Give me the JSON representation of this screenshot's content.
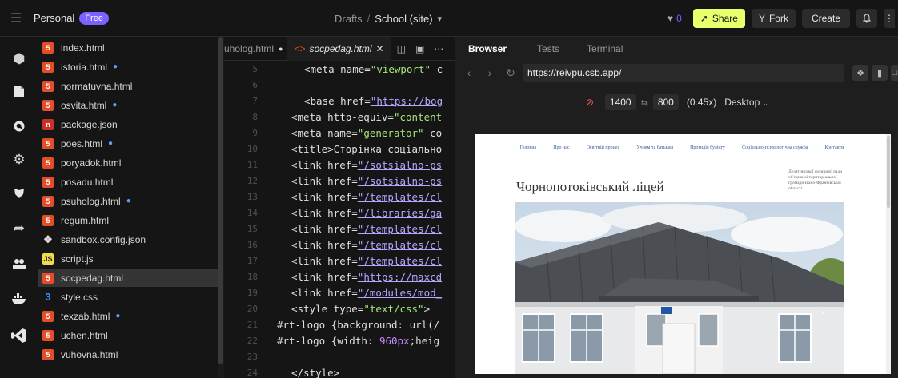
{
  "topbar": {
    "workspace": "Personal",
    "plan_badge": "Free",
    "breadcrumb_drafts": "Drafts",
    "breadcrumb_sep": "/",
    "breadcrumb_title": "School (site)",
    "likes_count": "0",
    "share_label": "Share",
    "fork_label": "Fork",
    "create_label": "Create"
  },
  "activity_icons": [
    "cube-icon",
    "file-icon",
    "search-icon",
    "gear-icon",
    "shield-icon",
    "rocket-icon",
    "users-icon",
    "docker-icon",
    "vscode-icon"
  ],
  "files": [
    {
      "name": "index.html",
      "type": "html",
      "modified": false
    },
    {
      "name": "istoria.html",
      "type": "html",
      "modified": true
    },
    {
      "name": "normatuvna.html",
      "type": "html",
      "modified": false
    },
    {
      "name": "osvita.html",
      "type": "html",
      "modified": true
    },
    {
      "name": "package.json",
      "type": "json",
      "modified": false
    },
    {
      "name": "poes.html",
      "type": "html",
      "modified": true
    },
    {
      "name": "poryadok.html",
      "type": "html",
      "modified": false
    },
    {
      "name": "posadu.html",
      "type": "html",
      "modified": false
    },
    {
      "name": "psuholog.html",
      "type": "html",
      "modified": true
    },
    {
      "name": "regum.html",
      "type": "html",
      "modified": false
    },
    {
      "name": "sandbox.config.json",
      "type": "sb",
      "modified": false
    },
    {
      "name": "script.js",
      "type": "js",
      "modified": false
    },
    {
      "name": "socpedag.html",
      "type": "html",
      "modified": false,
      "active": true
    },
    {
      "name": "style.css",
      "type": "css",
      "modified": false
    },
    {
      "name": "texzab.html",
      "type": "html",
      "modified": true
    },
    {
      "name": "uchen.html",
      "type": "html",
      "modified": false
    },
    {
      "name": "vuhovna.html",
      "type": "html",
      "modified": false
    }
  ],
  "editor": {
    "tab_prev": "uholog.html",
    "tab_active": "socpedag.html",
    "code_lines": [
      {
        "n": "5",
        "parts": [
          [
            "tagc",
            "<meta name="
          ],
          [
            "str",
            "\"viewport\""
          ],
          [
            "tagc",
            " c"
          ]
        ]
      },
      {
        "n": "6",
        "parts": []
      },
      {
        "n": "7",
        "parts": [
          [
            "tagc",
            "<base href="
          ],
          [
            "link",
            "\"https://bog"
          ]
        ]
      },
      {
        "n": "8",
        "parts": [
          [
            "tagc",
            "<meta http-equiv="
          ],
          [
            "str",
            "\"content"
          ]
        ]
      },
      {
        "n": "9",
        "parts": [
          [
            "tagc",
            "<meta name="
          ],
          [
            "str",
            "\"generator\""
          ],
          [
            "tagc",
            " co"
          ]
        ]
      },
      {
        "n": "10",
        "parts": [
          [
            "tagc",
            "<title>Сторінка соціально"
          ]
        ]
      },
      {
        "n": "11",
        "parts": [
          [
            "tagc",
            "<link href="
          ],
          [
            "link",
            "\"/sotsialno-ps"
          ]
        ]
      },
      {
        "n": "12",
        "parts": [
          [
            "tagc",
            "<link href="
          ],
          [
            "link",
            "\"/sotsialno-ps"
          ]
        ]
      },
      {
        "n": "13",
        "parts": [
          [
            "tagc",
            "<link href="
          ],
          [
            "link",
            "\"/templates/cl"
          ]
        ]
      },
      {
        "n": "14",
        "parts": [
          [
            "tagc",
            "<link href="
          ],
          [
            "link",
            "\"/libraries/ga"
          ]
        ]
      },
      {
        "n": "15",
        "parts": [
          [
            "tagc",
            "<link href="
          ],
          [
            "link",
            "\"/templates/cl"
          ]
        ]
      },
      {
        "n": "16",
        "parts": [
          [
            "tagc",
            "<link href="
          ],
          [
            "link",
            "\"/templates/cl"
          ]
        ]
      },
      {
        "n": "17",
        "parts": [
          [
            "tagc",
            "<link href="
          ],
          [
            "link",
            "\"/templates/cl"
          ]
        ]
      },
      {
        "n": "18",
        "parts": [
          [
            "tagc",
            "<link href="
          ],
          [
            "link",
            "\"https://maxcd"
          ]
        ]
      },
      {
        "n": "19",
        "parts": [
          [
            "tagc",
            "<link href="
          ],
          [
            "link",
            "\"/modules/mod_"
          ]
        ]
      },
      {
        "n": "20",
        "parts": [
          [
            "tagc",
            "<style type="
          ],
          [
            "str",
            "\"text/css\""
          ],
          [
            "tagc",
            ">"
          ]
        ]
      },
      {
        "n": "21",
        "parts": [
          [
            "tagc",
            "#rt-logo {background: url(/"
          ]
        ]
      },
      {
        "n": "22",
        "parts": [
          [
            "tagc",
            "#rt-logo {width: "
          ],
          [
            "num",
            "960px"
          ],
          [
            "tagc",
            ";heig"
          ]
        ]
      },
      {
        "n": "23",
        "parts": []
      },
      {
        "n": "24",
        "parts": [
          [
            "tagc",
            "</style>"
          ]
        ]
      }
    ]
  },
  "preview": {
    "tabs": [
      "Browser",
      "Tests",
      "Terminal"
    ],
    "url": "https://reivpu.csb.app/",
    "width": "1400",
    "height": "800",
    "scale": "(0.45x)",
    "device": "Desktop"
  },
  "site": {
    "nav": [
      "Головна",
      "Про нас",
      "Освітній процес",
      "Учням та батькам",
      "Протидія булінгу",
      "Соціально-психологічна служба",
      "Контакти"
    ],
    "title": "Чорнопотоківський ліцей",
    "address": "Делятинської селищної ради об'єднаної територіальної громади Івано-Франківської області"
  },
  "colors": {
    "accent": "#7b61ff",
    "share": "#e9ff6b",
    "html_icon": "#e44d26",
    "string": "#a4e57a",
    "link": "#b9a4ff"
  }
}
